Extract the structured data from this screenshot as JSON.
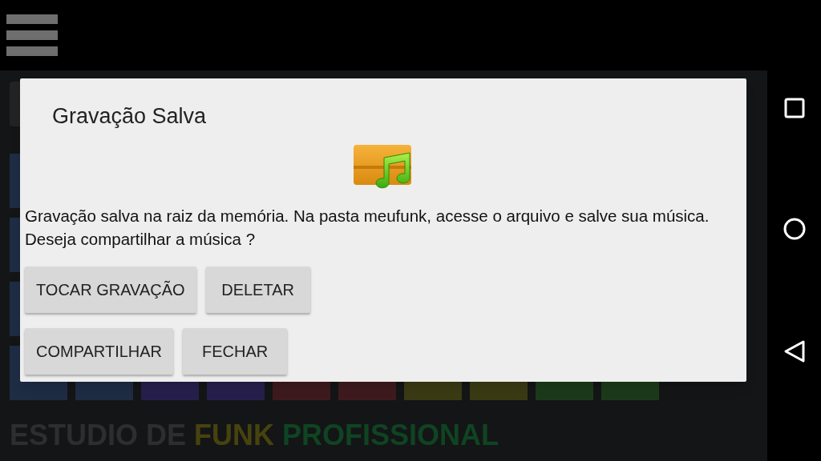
{
  "background": {
    "pad_rows": [
      {
        "kind": "edge",
        "pads": [
          {
            "color": "#1e2c44"
          }
        ]
      },
      {
        "kind": "edge",
        "pads": [
          {
            "color": "#1e2c44"
          }
        ]
      },
      {
        "kind": "edge",
        "pads": [
          {
            "color": "#1e2c44"
          }
        ]
      },
      {
        "kind": "full",
        "pads": [
          {
            "color": "#1e2c44"
          },
          {
            "color": "#1e2c44"
          },
          {
            "color": "#261f4c"
          },
          {
            "color": "#261f4c"
          },
          {
            "color": "#3e1a1e"
          },
          {
            "color": "#3e1a1e"
          },
          {
            "color": "#3a3a14"
          },
          {
            "color": "#3a3a14"
          },
          {
            "color": "#1c3a1a"
          },
          {
            "color": "#1c3a1a"
          }
        ]
      }
    ],
    "title_parts": [
      {
        "text": "ESTUDIO DE",
        "color": "#2e2e2e"
      },
      {
        "text": "FUNK",
        "color": "#47430f"
      },
      {
        "text": "PROFISSIONAL",
        "color": "#0f4422"
      }
    ]
  },
  "dialog": {
    "title": "Gravação Salva",
    "message": "Gravação salva na raiz da memória. Na pasta meufunk, acesse o arquivo e salve sua música. Deseja compartilhar a música ?",
    "button_rows": [
      [
        "TOCAR GRAVAÇÃO",
        "DELETAR"
      ],
      [
        "COMPARTILHAR",
        "FECHAR"
      ]
    ]
  }
}
